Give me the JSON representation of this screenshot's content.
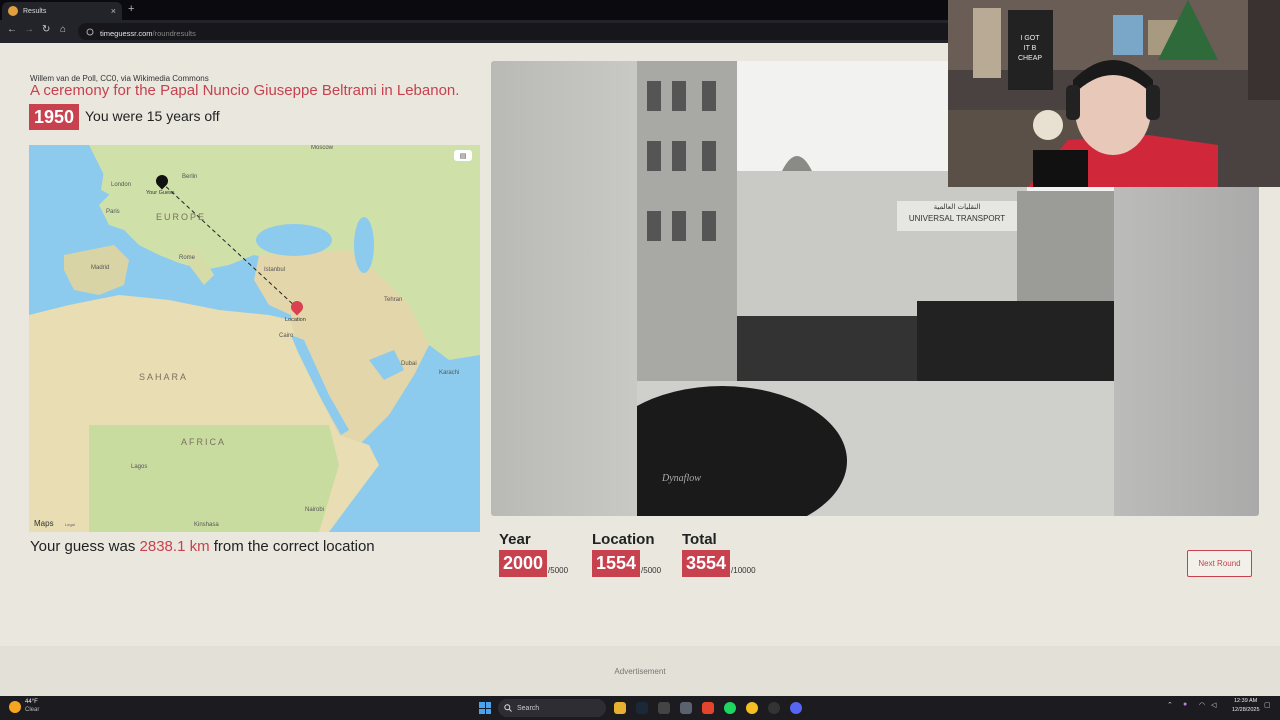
{
  "browser": {
    "tab_title": "Results",
    "tab_close": "×",
    "new_tab": "+",
    "url_host": "timeguessr.com",
    "url_path": "/roundresults",
    "nav_back": "←",
    "nav_forward": "→",
    "nav_reload": "↻",
    "nav_home": "⌂"
  },
  "round": {
    "credit": "Willem van de Poll, CC0, via Wikimedia Commons",
    "headline": "A ceremony for the Papal Nuncio Giuseppe Beltrami in Lebanon.",
    "correct_year": "1950",
    "years_off": "You were 15 years off",
    "distance_prefix": "Your guess was",
    "distance_value": "2838.1 km",
    "distance_suffix": "from the correct location"
  },
  "map": {
    "labels": [
      "Moscow",
      "Berlin",
      "London",
      "Paris",
      "EUROPE",
      "Rome",
      "Madrid",
      "Istanbul",
      "Tehran",
      "Cairo",
      "Dubai",
      "Karachi",
      "SAHARA",
      "AFRICA",
      "Lagos",
      "Nairobi",
      "Kinshasa"
    ],
    "guess_label": "Your Guess",
    "location_label": "Location",
    "maps_logo": " Maps",
    "legal": "Legal",
    "layers_icon": "▤"
  },
  "scores": {
    "year_label": "Year",
    "year_value": "2000",
    "year_max": "/5000",
    "location_label": "Location",
    "location_value": "1554",
    "location_max": "/5000",
    "total_label": "Total",
    "total_value": "3554",
    "total_max": "/10000",
    "next_round": "Next Round"
  },
  "ad_label": "Advertisement",
  "photo_text": {
    "sign": "UNIVERSAL TRANSPORT",
    "sign_arabic": "النقليات العالمية",
    "car_badge": "Dynaflow"
  },
  "webcam_text": {
    "shirt_line1": "I GOT",
    "shirt_line2": "IT B",
    "shirt_line3": "CHEAP"
  },
  "taskbar": {
    "weather_temp": "44°F",
    "weather_cond": "Clear",
    "search_label": "Search",
    "time": "12:39 AM",
    "date": "12/28/2025"
  },
  "colors": {
    "accent": "#c8414e",
    "page_bg": "#e9e7de"
  }
}
